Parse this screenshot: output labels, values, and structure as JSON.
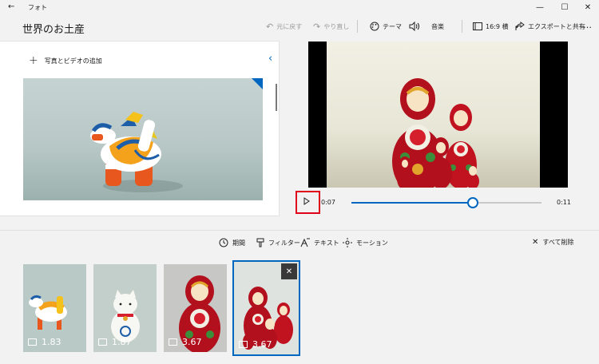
{
  "titlebar": {
    "app_title": "フォト"
  },
  "header": {
    "title": "世界のお土産"
  },
  "toolbar": {
    "undo": "元に戻す",
    "redo": "やり直し",
    "theme": "テーマ",
    "music": "音楽",
    "aspect": "16:9 横",
    "export": "エクスポートと共有",
    "more": "…"
  },
  "library": {
    "add_label": "写真とビデオの追加"
  },
  "player": {
    "current_time": "0:07",
    "total_time": "0:11",
    "progress": 0.64
  },
  "timeline_tools": {
    "duration": "期間",
    "filters": "フィルター",
    "text": "テキスト",
    "motion": "モーション",
    "remove_all": "すべて削除"
  },
  "storyboard": [
    {
      "duration": "1.83"
    },
    {
      "duration": "1.87"
    },
    {
      "duration": "3.67"
    },
    {
      "duration": "3.67"
    }
  ],
  "colors": {
    "accent": "#0067c0",
    "highlight": "#e0001b"
  }
}
